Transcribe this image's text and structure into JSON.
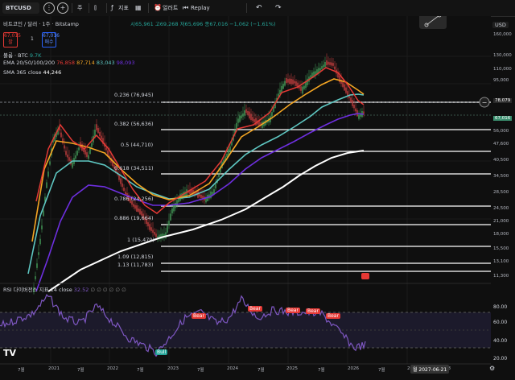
{
  "toolbar": {
    "symbol": "BTCUSD",
    "interval": "주",
    "indicators_label": "지표",
    "alert_label": "얼러트",
    "replay_label": "Replay"
  },
  "header": {
    "title": "비트코인 / 달러 · 1주 · Bitstamp",
    "ohlc": "시65,961 고69,268 저65,696 종67,016 −1,062 (−1.61%)",
    "sell_price": "67,015",
    "sell_label": "팔",
    "spread": "1",
    "buy_price": "67,016",
    "buy_label": "매수",
    "vol_label": "볼륨 · BTC",
    "vol_value": "9.7K",
    "ema_label": "EMA 20/50/100/200",
    "ema_values": [
      "76,858",
      "87,714",
      "83,043",
      "98,093"
    ],
    "sma_label": "SMA 365 close",
    "sma_value": "44,246",
    "currency": "USD"
  },
  "fib_levels": [
    {
      "label": "0.236 (76,945)"
    },
    {
      "label": "0.382 (56,636)"
    },
    {
      "label": "0.5 (44,710)"
    },
    {
      "label": "0.618 (34,511)"
    },
    {
      "label": "0.786 (24,256)"
    },
    {
      "label": "0.886 (19,664)"
    },
    {
      "label": "1 (15,479)"
    },
    {
      "label": "1.09 (12,815)"
    },
    {
      "label": "1.13 (11,783)"
    }
  ],
  "price_axis": [
    "160,000",
    "130,000",
    "110,000",
    "95,000",
    "78,079",
    "67,016",
    "56,000",
    "47,600",
    "40,500",
    "34,500",
    "28,500",
    "24,500",
    "21,000",
    "18,000",
    "15,500",
    "13,100",
    "11,300"
  ],
  "price_tags": {
    "alert": "78,079",
    "current": "67,016"
  },
  "rsi": {
    "label": "RSI 다이버전스 지표 14 close",
    "value": "32.52",
    "axis": [
      "80.00",
      "60.00",
      "40.00",
      "20.00"
    ],
    "bear_labels": [
      "Bear",
      "Bear",
      "Bear",
      "Bear",
      "Bear"
    ],
    "bull_label": "Bull"
  },
  "time_axis": [
    "7월",
    "2021",
    "7월",
    "2022",
    "7월",
    "2023",
    "7월",
    "2024",
    "7월",
    "2025",
    "7월",
    "2026",
    "7월",
    "2027",
    "2028"
  ],
  "time_cursor": "월 2027-06-21",
  "logo": "TV",
  "colors": {
    "bg": "#0f0f0f",
    "ema20": "#e53935",
    "ema50": "#f5a623",
    "ema100": "#5ec7c2",
    "ema200": "#6e2fe0",
    "sma365": "#ffffff",
    "rsi": "#7e57c2",
    "candle_up": "#3f8f52",
    "candle_down": "#b53a3a",
    "current_tag": "#3a8f6f"
  }
}
